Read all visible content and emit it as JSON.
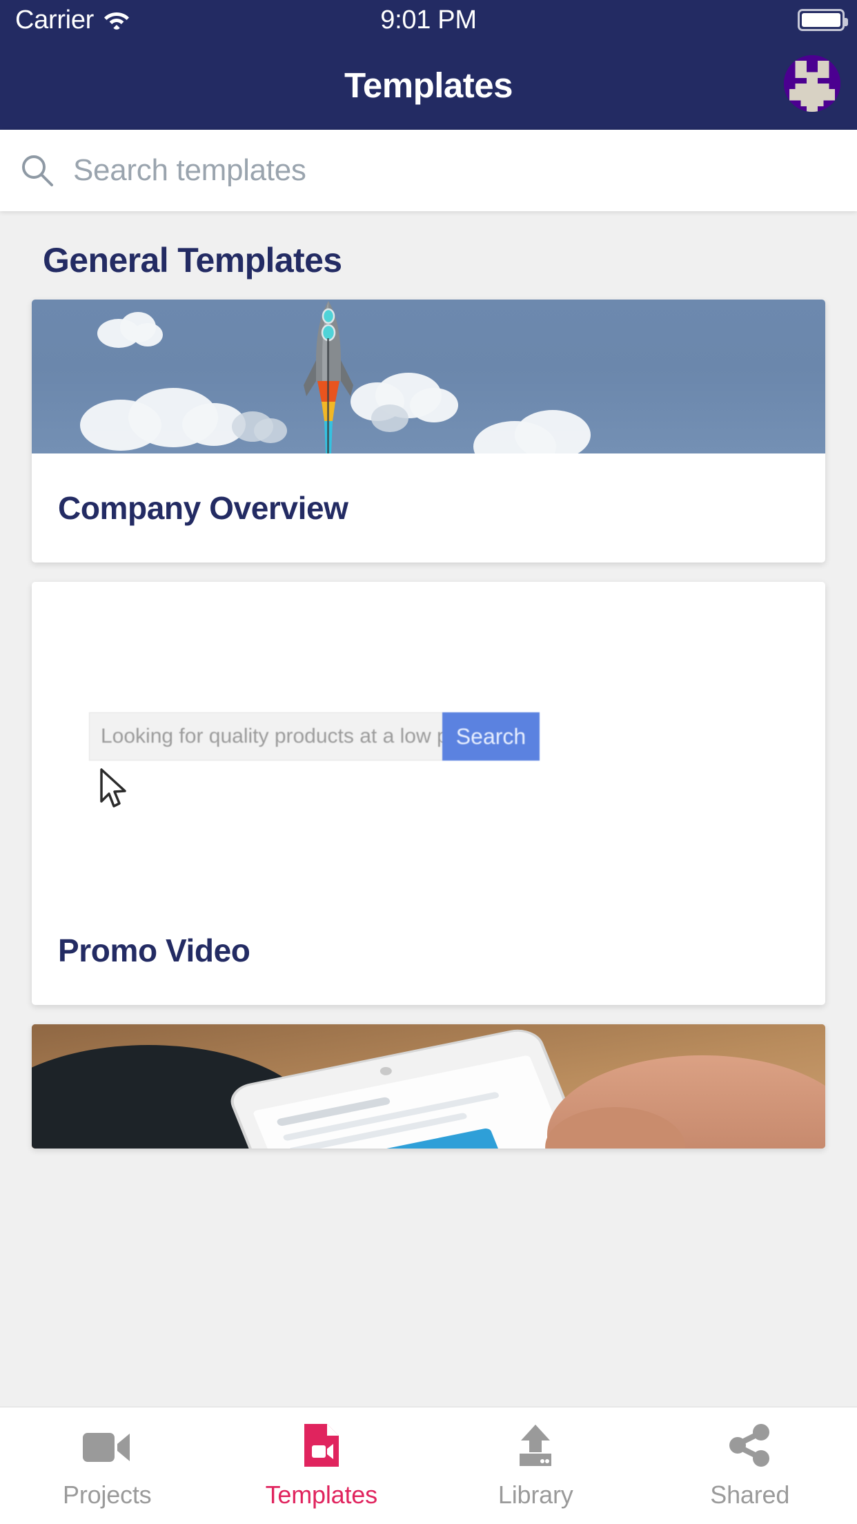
{
  "theme": {
    "navbar_bg": "#232B63",
    "page_bg": "#F0F0F0",
    "heading_color": "#232B63",
    "accent_active": "#E0245E",
    "tab_inactive": "#9A9A9A",
    "mock_button_blue": "#5B82E0"
  },
  "status_bar": {
    "carrier": "Carrier",
    "wifi_icon": "wifi-icon",
    "time": "9:01 PM",
    "battery_icon": "battery-full-icon"
  },
  "navbar": {
    "title": "Templates",
    "avatar_icon": "avatar-identicon"
  },
  "search": {
    "icon": "search-icon",
    "placeholder": "Search templates",
    "value": ""
  },
  "section": {
    "title": "General Templates"
  },
  "cards": [
    {
      "title": "Company Overview",
      "media": "rocket-launch-illustration"
    },
    {
      "title": "Promo Video",
      "media": "search-bar-mockup",
      "mock_field_text": "Looking for quality products at a low price?",
      "mock_button_label": "Search",
      "cursor_icon": "mouse-pointer-icon"
    },
    {
      "title": "",
      "media": "hand-holding-phone-photo"
    }
  ],
  "tabbar": {
    "items": [
      {
        "label": "Projects",
        "icon": "video-camera-icon",
        "active": false
      },
      {
        "label": "Templates",
        "icon": "video-file-icon",
        "active": true
      },
      {
        "label": "Library",
        "icon": "upload-icon",
        "active": false
      },
      {
        "label": "Shared",
        "icon": "share-nodes-icon",
        "active": false
      }
    ]
  }
}
